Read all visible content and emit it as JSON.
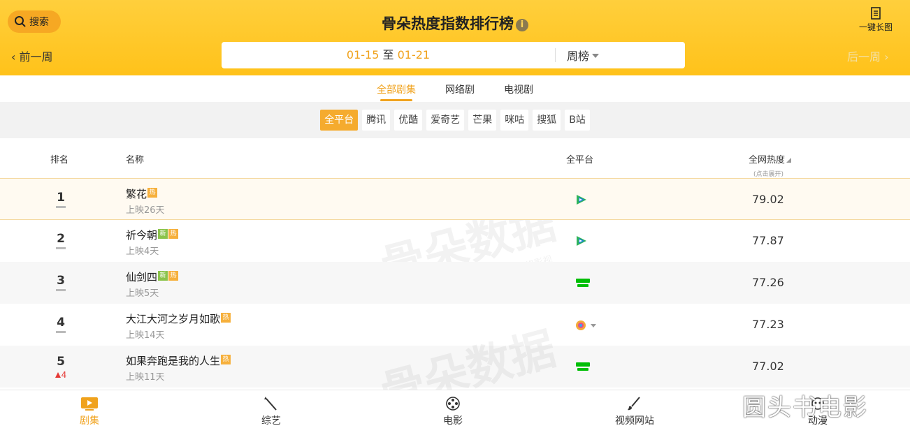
{
  "header": {
    "search_label": "搜索",
    "title": "骨朵热度指数排行榜",
    "long_image_label": "一键长图",
    "prev_week": "前一周",
    "next_week": "后一周",
    "date_start": "01-15",
    "date_sep": "至",
    "date_end": "01-21",
    "period": "周榜"
  },
  "type_tabs": [
    {
      "label": "全部剧集",
      "active": true
    },
    {
      "label": "网络剧",
      "active": false
    },
    {
      "label": "电视剧",
      "active": false
    }
  ],
  "platforms": [
    {
      "label": "全平台",
      "active": true
    },
    {
      "label": "腾讯"
    },
    {
      "label": "优酷"
    },
    {
      "label": "爱奇艺"
    },
    {
      "label": "芒果"
    },
    {
      "label": "咪咕"
    },
    {
      "label": "搜狐"
    },
    {
      "label": "B站"
    }
  ],
  "table": {
    "col_rank": "排名",
    "col_name": "名称",
    "col_platform": "全平台",
    "col_heat": "全网热度",
    "col_heat_sub": "(点击展开)",
    "rows": [
      {
        "rank": "1",
        "title": "繁花",
        "badges": [
          "热"
        ],
        "days": "上映26天",
        "platform": "tencent-video-icon",
        "heat": "79.02"
      },
      {
        "rank": "2",
        "title": "祈今朝",
        "badges": [
          "新",
          "热"
        ],
        "days": "上映4天",
        "platform": "tencent-video-icon",
        "heat": "77.87"
      },
      {
        "rank": "3",
        "title": "仙剑四",
        "badges": [
          "新",
          "热"
        ],
        "days": "上映5天",
        "platform": "iqiyi-icon",
        "heat": "77.26"
      },
      {
        "rank": "4",
        "title": "大江大河之岁月如歌",
        "badges": [
          "热"
        ],
        "days": "上映14天",
        "platform": "multi-platform-icon",
        "heat": "77.23"
      },
      {
        "rank": "5",
        "rank_change": "4",
        "title": "如果奔跑是我的人生",
        "badges": [
          "热"
        ],
        "days": "上映11天",
        "platform": "iqiyi-icon",
        "heat": "77.02"
      }
    ]
  },
  "watermark": {
    "text": "骨朵数据",
    "sub": "@骨朵网络影视"
  },
  "bottom_nav": [
    {
      "label": "剧集",
      "icon": "tv-play-icon",
      "active": true
    },
    {
      "label": "综艺",
      "icon": "magic-wand-icon"
    },
    {
      "label": "电影",
      "icon": "film-reel-icon"
    },
    {
      "label": "视频网站",
      "icon": "brush-icon"
    },
    {
      "label": "动漫",
      "icon": "anime-icon"
    }
  ],
  "corner_watermark": "圆头书电影",
  "colors": {
    "accent": "#f0a21c",
    "header": "#ffc72c",
    "hot_badge": "#f6b03c",
    "new_badge": "#8bc34a"
  }
}
